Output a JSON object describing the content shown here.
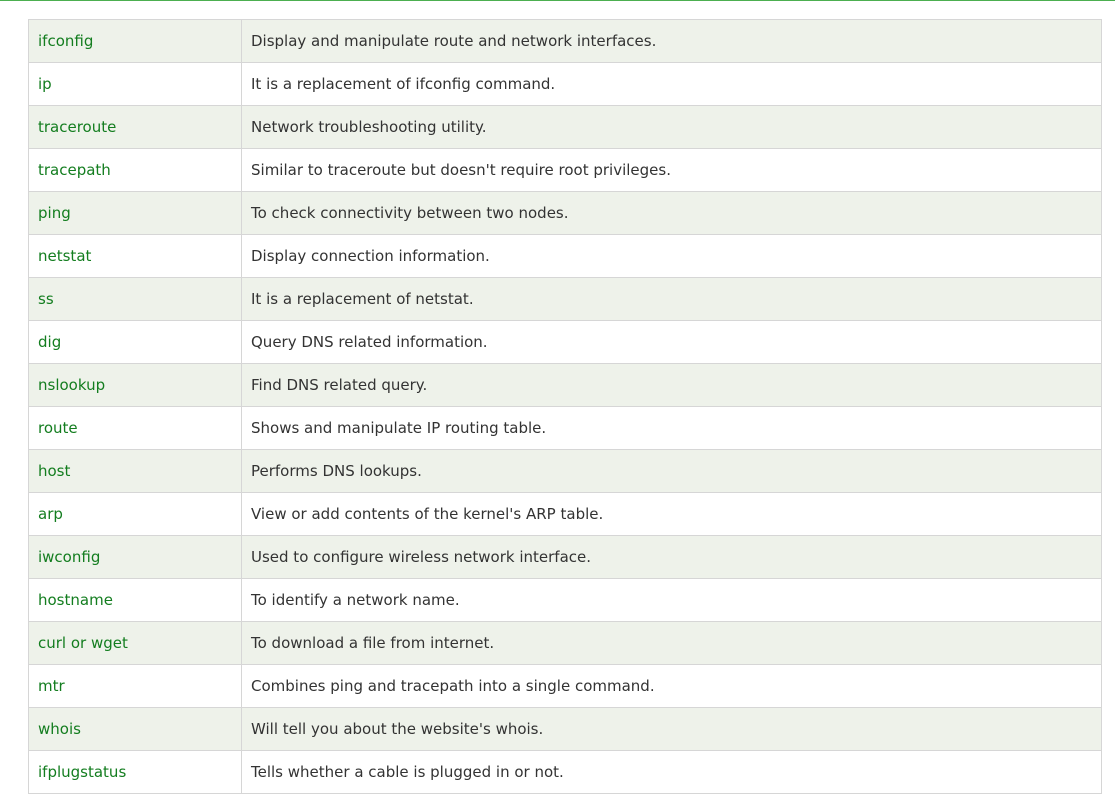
{
  "table": {
    "rows": [
      {
        "command": "ifconfig",
        "description": "Display and manipulate route and network interfaces."
      },
      {
        "command": "ip",
        "description": "It is a replacement of ifconfig command."
      },
      {
        "command": "traceroute",
        "description": "Network troubleshooting utility."
      },
      {
        "command": "tracepath",
        "description": "Similar to traceroute but doesn't require root privileges."
      },
      {
        "command": "ping",
        "description": "To check connectivity between two nodes."
      },
      {
        "command": "netstat",
        "description": "Display connection information."
      },
      {
        "command": "ss",
        "description": "It is a replacement of netstat."
      },
      {
        "command": "dig",
        "description": "Query DNS related information."
      },
      {
        "command": "nslookup",
        "description": "Find DNS related query."
      },
      {
        "command": "route",
        "description": "Shows and manipulate IP routing table."
      },
      {
        "command": "host",
        "description": "Performs DNS lookups."
      },
      {
        "command": "arp",
        "description": "View or add contents of the kernel's ARP table."
      },
      {
        "command": "iwconfig",
        "description": "Used to configure wireless network interface."
      },
      {
        "command": "hostname",
        "description": "To identify a network name."
      },
      {
        "command": "curl or wget",
        "description": "To download a file from internet."
      },
      {
        "command": "mtr",
        "description": "Combines ping and tracepath into a single command."
      },
      {
        "command": "whois",
        "description": "Will tell you about the website's whois."
      },
      {
        "command": "ifplugstatus",
        "description": "Tells whether a cable is plugged in or not."
      }
    ]
  },
  "colors": {
    "command_text": "#137d1f",
    "row_shade": "#eef2ea",
    "border": "#d6d6d6",
    "accent_rule": "#4caf50"
  }
}
